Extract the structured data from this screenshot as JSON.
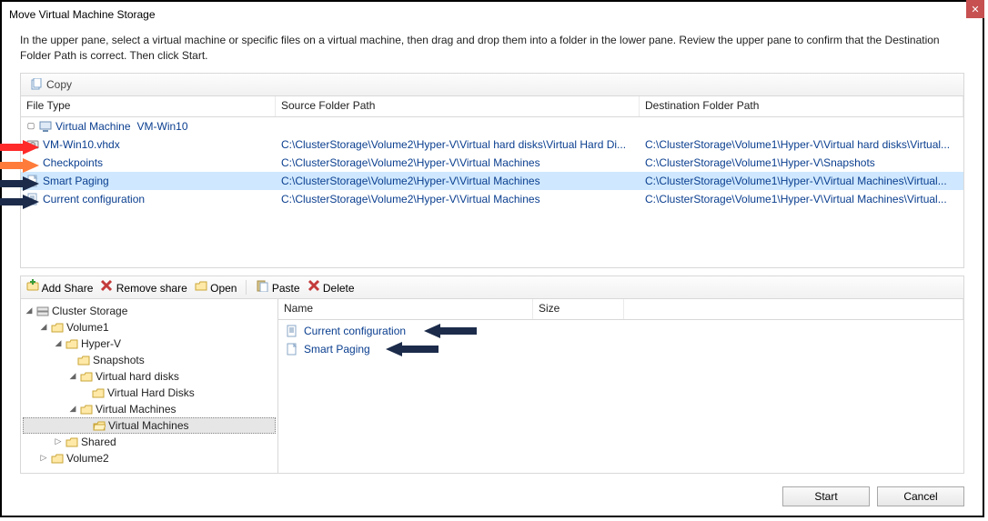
{
  "title": "Move Virtual Machine Storage",
  "instructions": "In the upper pane, select a virtual machine or specific files on a virtual machine, then drag and drop them into a folder in the lower pane.  Review the upper pane to confirm that the Destination Folder Path is correct. Then click Start.",
  "toolbar_upper": {
    "copy": "Copy"
  },
  "upper_grid": {
    "headers": {
      "c0": "File Type",
      "c1": "Source Folder Path",
      "c2": "Destination Folder Path"
    },
    "row_vm": {
      "name_prefix": "Virtual Machine",
      "name": "VM-Win10"
    },
    "row_vhdx": {
      "name": "VM-Win10.vhdx",
      "src": "C:\\ClusterStorage\\Volume2\\Hyper-V\\Virtual hard disks\\Virtual Hard Di...",
      "dst": "C:\\ClusterStorage\\Volume1\\Hyper-V\\Virtual hard disks\\Virtual..."
    },
    "row_checkpoints": {
      "name": "Checkpoints",
      "src": "C:\\ClusterStorage\\Volume2\\Hyper-V\\Virtual Machines",
      "dst": "C:\\ClusterStorage\\Volume1\\Hyper-V\\Snapshots"
    },
    "row_smartpaging": {
      "name": "Smart Paging",
      "src": "C:\\ClusterStorage\\Volume2\\Hyper-V\\Virtual Machines",
      "dst": "C:\\ClusterStorage\\Volume1\\Hyper-V\\Virtual Machines\\Virtual..."
    },
    "row_currentconfig": {
      "name": "Current configuration",
      "src": "C:\\ClusterStorage\\Volume2\\Hyper-V\\Virtual Machines",
      "dst": "C:\\ClusterStorage\\Volume1\\Hyper-V\\Virtual Machines\\Virtual..."
    }
  },
  "toolbar_lower": {
    "add_share": "Add Share",
    "remove_share": "Remove share",
    "open": "Open",
    "paste": "Paste",
    "delete": "Delete"
  },
  "tree": {
    "root": "Cluster Storage",
    "vol1": "Volume1",
    "hyperv": "Hyper-V",
    "snapshots": "Snapshots",
    "vhd": "Virtual hard disks",
    "vhd_child": "Virtual Hard Disks",
    "vm": "Virtual Machines",
    "vm_child": "Virtual Machines",
    "shared": "Shared",
    "vol2": "Volume2"
  },
  "list": {
    "headers": {
      "name": "Name",
      "size": "Size"
    },
    "row_config": "Current configuration",
    "row_paging": "Smart Paging"
  },
  "buttons": {
    "start": "Start",
    "cancel": "Cancel"
  },
  "colors": {
    "arrow_red": "#ff2a2a",
    "arrow_orange": "#ff7b3a",
    "arrow_navy": "#1c2b4a",
    "link_blue": "#0a3e8f",
    "selection": "#cfe8ff"
  }
}
